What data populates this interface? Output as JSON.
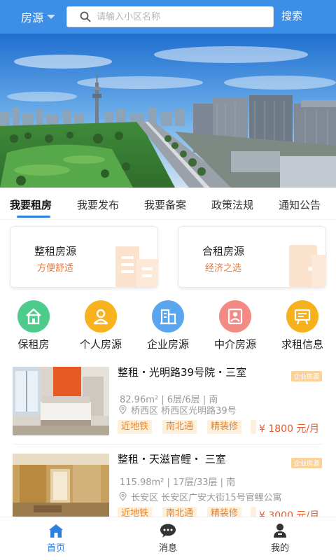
{
  "header": {
    "city_label": "房源",
    "search_placeholder": "请输入小区名称",
    "search_button": "搜索"
  },
  "tabs": [
    {
      "label": "我要租房",
      "active": true
    },
    {
      "label": "我要发布",
      "active": false
    },
    {
      "label": "我要备案",
      "active": false
    },
    {
      "label": "政策法规",
      "active": false
    },
    {
      "label": "通知公告",
      "active": false
    }
  ],
  "cards": [
    {
      "title": "整租房源",
      "subtitle": "方便舒适",
      "icon": "building-icon"
    },
    {
      "title": "合租房源",
      "subtitle": "经济之选",
      "icon": "door-icon"
    }
  ],
  "quick_links": [
    {
      "label": "保租房",
      "icon": "house-icon",
      "color": "#4ccb8a"
    },
    {
      "label": "个人房源",
      "icon": "person-icon",
      "color": "#f7b21e"
    },
    {
      "label": "企业房源",
      "icon": "office-building-icon",
      "color": "#5aa5ef"
    },
    {
      "label": "中介房源",
      "icon": "agent-icon",
      "color": "#f48a84"
    },
    {
      "label": "求租信息",
      "icon": "notice-board-icon",
      "color": "#f6b11d"
    }
  ],
  "listings": [
    {
      "title": "整租・光明路39号院・三室",
      "tag": "企业房源",
      "area": "82.96m²",
      "floor": "6层/6层",
      "orientation": "南",
      "address": "桥西区  桥西区光明路39号",
      "chips": [
        "近地铁",
        "南北通",
        "精装修"
      ],
      "price": "¥ 1800 元/月"
    },
    {
      "title": "整租・天滋官鲤・ 三室",
      "tag": "企业房源",
      "area": "115.98m²",
      "floor": "17层/33层",
      "orientation": "南",
      "address": "长安区  长安区广安大街15号官鲤公寓",
      "chips": [
        "近地铁",
        "南北通",
        "精装修"
      ],
      "price": "¥ 3000 元/月"
    }
  ],
  "bottom_nav": [
    {
      "label": "首页",
      "icon": "home-icon",
      "active": true
    },
    {
      "label": "消息",
      "icon": "message-icon",
      "active": false
    },
    {
      "label": "我的",
      "icon": "user-icon",
      "active": false
    }
  ],
  "colors": {
    "header": "#3d8ee6",
    "accent": "#2d7fe0",
    "price": "#e55a2b",
    "chip_bg": "#fdf0dc",
    "chip_text": "#e8852a"
  }
}
